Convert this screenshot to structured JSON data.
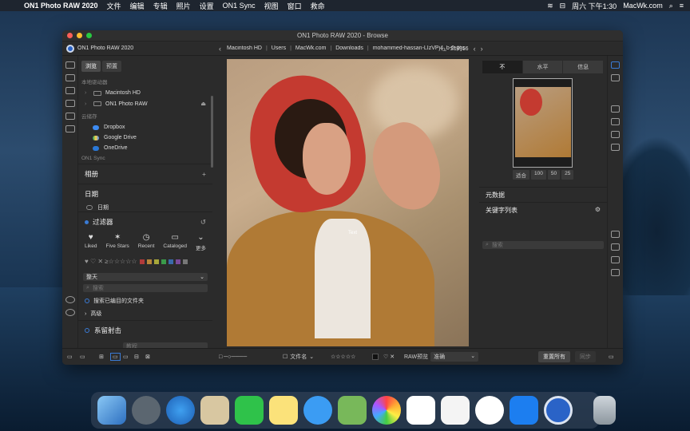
{
  "menubar": {
    "app_name": "ON1 Photo RAW 2020",
    "items": [
      "文件",
      "编辑",
      "专辑",
      "照片",
      "设置",
      "ON1 Sync",
      "视图",
      "窗口",
      "救命"
    ],
    "clock": "周六 下午1:30",
    "site": "MacWk.com"
  },
  "window": {
    "title": "ON1 Photo RAW 2020 - Browse",
    "app_label": "ON1 Photo RAW 2020"
  },
  "breadcrumb": {
    "parts": [
      "Macintosh HD",
      "Users",
      "MacWk.com",
      "Downloads",
      "mohammed-hassan-LIzVPj4_b-0-uns"
    ],
    "counter": "21的16"
  },
  "left_panel": {
    "tabs": [
      "浏览",
      "预置"
    ],
    "drives_label": "本地驱动器",
    "drives": [
      "Macintosh HD",
      "ON1 Photo RAW"
    ],
    "cloud_label": "云储存",
    "cloud": [
      "Dropbox",
      "Google Drive",
      "OneDrive"
    ],
    "sync_label": "ON1 Sync",
    "albums": "相册",
    "dates": "日期",
    "dates_item": "日期",
    "filters": "过滤器",
    "filter_buttons": [
      "Liked",
      "Five Stars",
      "Recent",
      "Cataloged",
      "更多"
    ],
    "rating_symbols": "♥ ♡ ✕   ≥☆☆☆☆☆",
    "period": "整天",
    "search_placeholder": "搜索",
    "catalog_option": "搜索已编目的文件夹",
    "advanced": "高级",
    "series": "系留射击",
    "series_field": "教程"
  },
  "right_panel": {
    "tabs": [
      "不",
      "水平",
      "信息"
    ],
    "zoom": [
      "适合",
      "100",
      "50",
      "25"
    ],
    "metadata": "元数据",
    "keywords": "关键字列表",
    "keyword_search": "搜索"
  },
  "photo": {
    "overlay_text": "Text"
  },
  "bottom_bar": {
    "sort": "文件名",
    "stars": "☆☆☆☆☆",
    "raw_label": "RAW预览",
    "raw_value": "准确",
    "reset": "重置所有",
    "sync": "同步"
  },
  "colors": {
    "accent": "#3a7bd5",
    "scarf": "#c43a30",
    "jacket": "#b07a35"
  }
}
